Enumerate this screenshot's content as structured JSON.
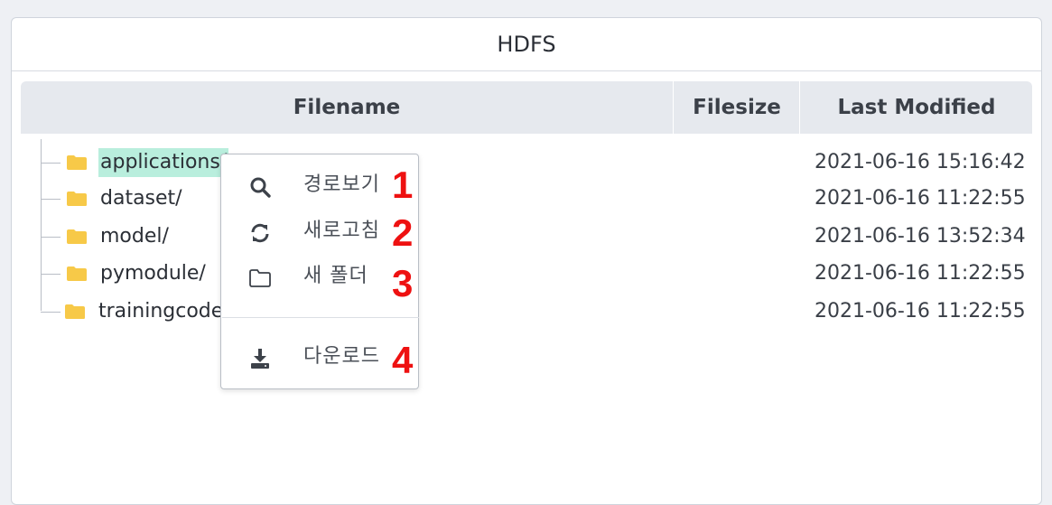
{
  "panel": {
    "title": "HDFS"
  },
  "table": {
    "columns": {
      "filename": "Filename",
      "filesize": "Filesize",
      "modified": "Last Modified"
    },
    "rows": [
      {
        "name": "applications/",
        "size": "",
        "modified": "2021-06-16 15:16:42",
        "selected": true
      },
      {
        "name": "dataset/",
        "size": "",
        "modified": "2021-06-16 11:22:55",
        "selected": false
      },
      {
        "name": "model/",
        "size": "",
        "modified": "2021-06-16 13:52:34",
        "selected": false
      },
      {
        "name": "pymodule/",
        "size": "",
        "modified": "2021-06-16 11:22:55",
        "selected": false
      },
      {
        "name": "trainingcode",
        "size": "",
        "modified": "2021-06-16 11:22:55",
        "selected": false
      }
    ]
  },
  "context_menu": {
    "items": [
      {
        "label": "경로보기",
        "icon": "search-icon",
        "marker": "1"
      },
      {
        "label": "새로고침",
        "icon": "refresh-icon",
        "marker": "2"
      },
      {
        "label": "새 폴더",
        "icon": "folder-outline-icon",
        "marker": "3"
      },
      {
        "label": "다운로드",
        "icon": "download-icon",
        "marker": "4"
      }
    ]
  },
  "colors": {
    "folder": "#f7c948",
    "selection": "#b9eedd",
    "annotation": "#ee1111",
    "header_bg": "#e6e9ee"
  }
}
